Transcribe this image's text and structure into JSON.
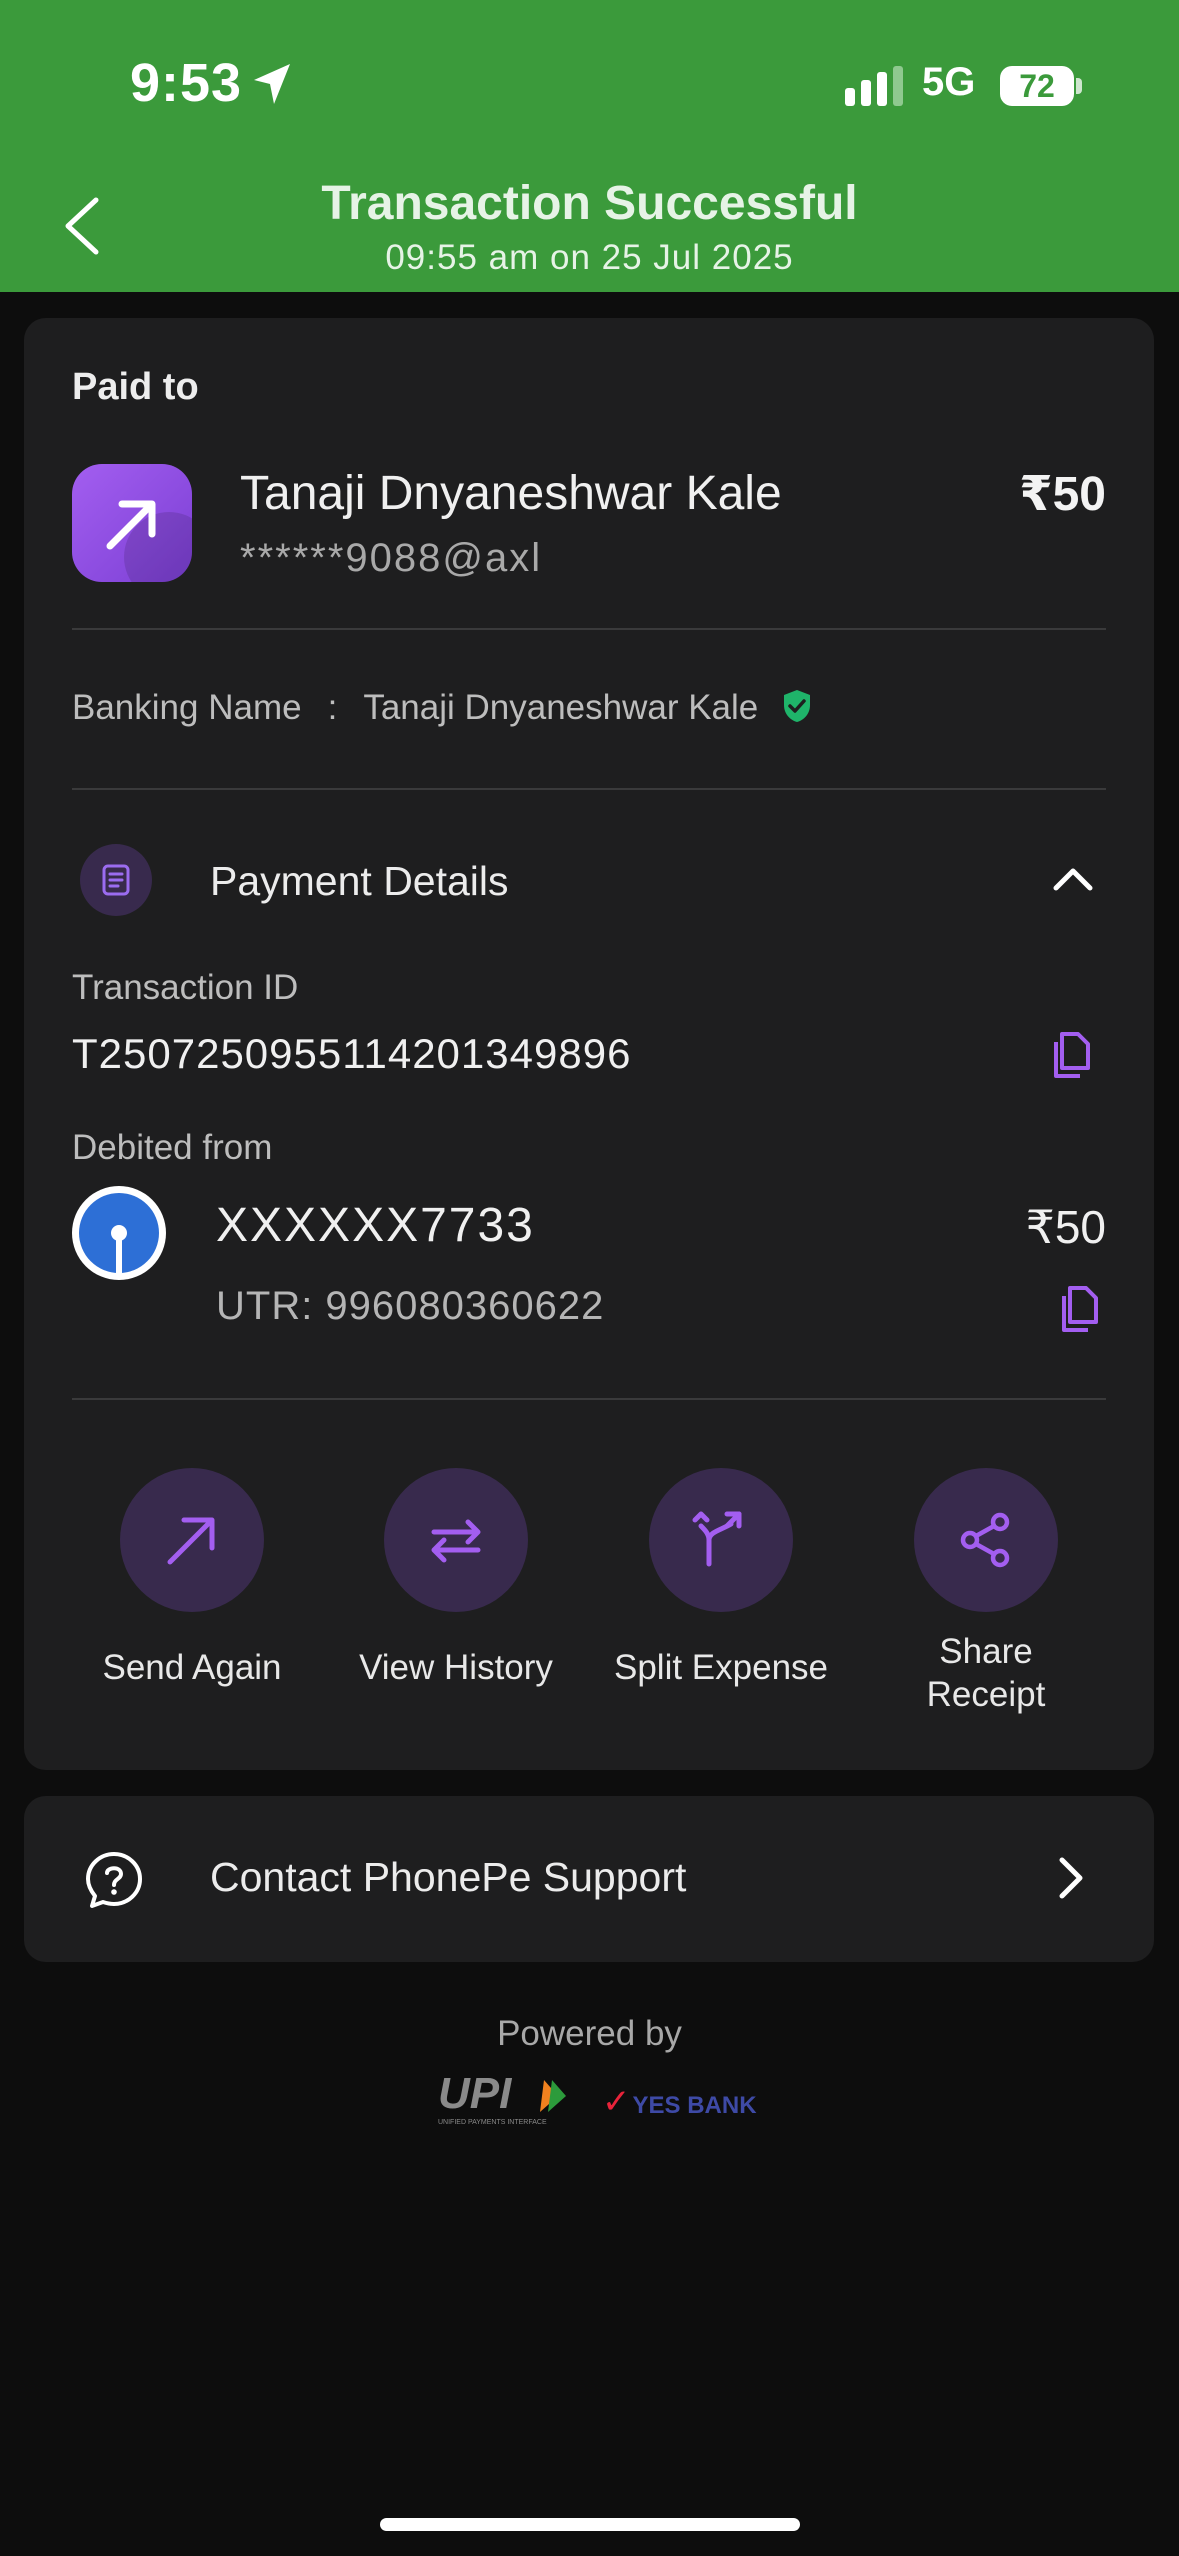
{
  "status_bar": {
    "time": "9:53",
    "network": "5G",
    "battery": "72"
  },
  "header": {
    "title": "Transaction Successful",
    "subtitle": "09:55 am on 25 Jul 2025"
  },
  "payee": {
    "section_label": "Paid to",
    "name": "Tanaji Dnyaneshwar Kale",
    "upi_id": "******9088@axl",
    "amount": "₹50",
    "banking_name_label": "Banking Name",
    "banking_name_sep": ":",
    "banking_name": "Tanaji Dnyaneshwar Kale"
  },
  "payment_details": {
    "title": "Payment Details",
    "transaction_id_label": "Transaction ID",
    "transaction_id": "T2507250955114201349896",
    "debited_from_label": "Debited from",
    "account": "XXXXXX7733",
    "utr": "UTR: 996080360622",
    "amount": "₹50"
  },
  "actions": [
    {
      "label": "Send Again",
      "icon": "arrow-up-right-icon"
    },
    {
      "label": "View History",
      "icon": "swap-arrows-icon"
    },
    {
      "label": "Split Expense",
      "icon": "split-arrows-icon"
    },
    {
      "label": "Share Receipt",
      "icon": "share-icon"
    }
  ],
  "support": {
    "label": "Contact PhonePe Support"
  },
  "footer": {
    "powered_by": "Powered by",
    "upi_logo": "UPI",
    "upi_tagline": "UNIFIED PAYMENTS INTERFACE",
    "bank_logo": "YES BANK"
  },
  "colors": {
    "header_green": "#3b9a3b",
    "accent_purple": "#a35ef0",
    "icon_bg": "#382a4d",
    "card_bg": "#1e1e1f"
  }
}
